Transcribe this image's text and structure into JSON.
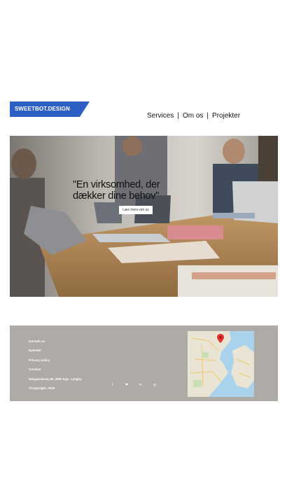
{
  "brand": {
    "logo_text": "SWEETBOT.DESIGN",
    "color": "#2d5fc4"
  },
  "nav": {
    "items": [
      {
        "label": "Services"
      },
      {
        "label": "Om os"
      },
      {
        "label": "Projekter"
      }
    ],
    "separator": "|"
  },
  "hero": {
    "headline": "\"En virksomhed, der dækker dine behov\"",
    "button_label": "Læs mere om os"
  },
  "footer": {
    "background": "#aeaaa6",
    "links": [
      {
        "label": "Kontakt os"
      },
      {
        "label": "Nyheder"
      },
      {
        "label": "Privacy policy"
      },
      {
        "label": "Cookies"
      }
    ],
    "address": "Hørgaardsvej 30, 2800 Kgs. Lyngby",
    "copyright": "©Copyright, 2018",
    "social": [
      {
        "icon": "facebook-icon",
        "glyph": "f"
      },
      {
        "icon": "twitter-icon",
        "glyph": "❤"
      },
      {
        "icon": "linkedin-icon",
        "glyph": "in"
      },
      {
        "icon": "instagram-icon",
        "glyph": "◎"
      }
    ]
  }
}
